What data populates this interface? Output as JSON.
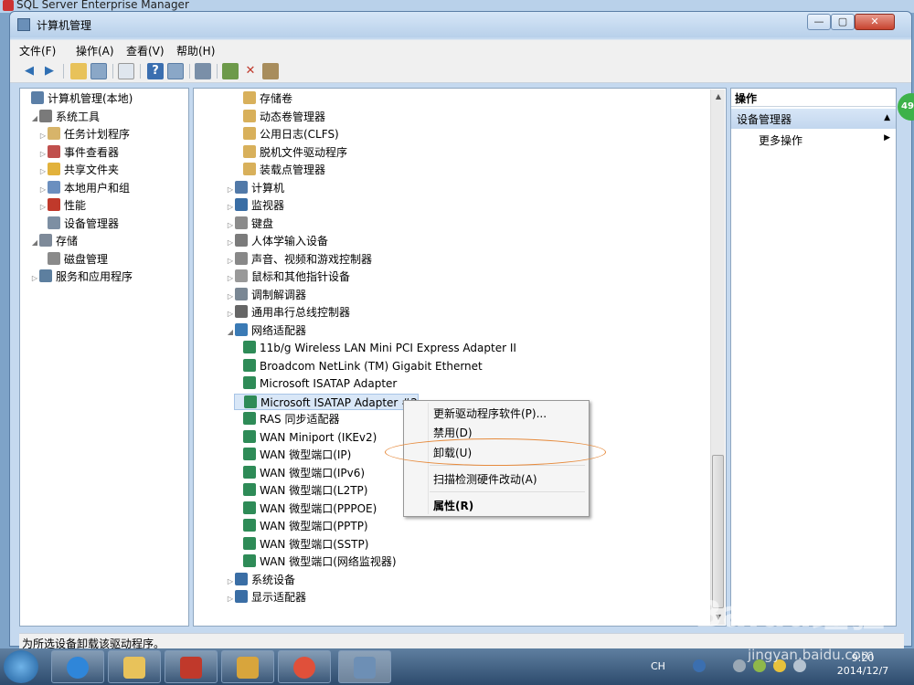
{
  "background_window_title": "SQL Server Enterprise Manager",
  "window": {
    "title": "计算机管理",
    "min": "—",
    "max": "▢",
    "close": "✕"
  },
  "menu": [
    "文件(F)",
    "操作(A)",
    "查看(V)",
    "帮助(H)"
  ],
  "left_tree": [
    {
      "label": "计算机管理(本地)",
      "level": 0,
      "arrow": "",
      "icon": "computer-mgmt-icon",
      "color": "#5b7fa7"
    },
    {
      "label": "系统工具",
      "level": 1,
      "arrow": "◢",
      "icon": "tools-icon",
      "color": "#7a7a7a"
    },
    {
      "label": "任务计划程序",
      "level": 2,
      "arrow": "▷",
      "icon": "clock-icon",
      "color": "#d7b46a"
    },
    {
      "label": "事件查看器",
      "level": 2,
      "arrow": "▷",
      "icon": "event-viewer-icon",
      "color": "#c0504d"
    },
    {
      "label": "共享文件夹",
      "level": 2,
      "arrow": "▷",
      "icon": "shared-folder-icon",
      "color": "#e2b23c"
    },
    {
      "label": "本地用户和组",
      "level": 2,
      "arrow": "▷",
      "icon": "users-icon",
      "color": "#6b8fbf"
    },
    {
      "label": "性能",
      "level": 2,
      "arrow": "▷",
      "icon": "performance-icon",
      "color": "#c0392b"
    },
    {
      "label": "设备管理器",
      "level": 2,
      "arrow": "",
      "icon": "device-manager-icon",
      "color": "#7d8fa3"
    },
    {
      "label": "存储",
      "level": 1,
      "arrow": "◢",
      "icon": "storage-icon",
      "color": "#7e8a99"
    },
    {
      "label": "磁盘管理",
      "level": 2,
      "arrow": "",
      "icon": "disk-icon",
      "color": "#8a8a8a"
    },
    {
      "label": "服务和应用程序",
      "level": 1,
      "arrow": "▷",
      "icon": "services-icon",
      "color": "#5d7f9f"
    }
  ],
  "device_tree": [
    {
      "label": "存储卷",
      "level": 2,
      "arrow": "",
      "icon": "volume-icon",
      "color": "#d8b05b"
    },
    {
      "label": "动态卷管理器",
      "level": 2,
      "arrow": "",
      "icon": "volume-icon",
      "color": "#d8b05b"
    },
    {
      "label": "公用日志(CLFS)",
      "level": 2,
      "arrow": "",
      "icon": "volume-icon",
      "color": "#d8b05b"
    },
    {
      "label": "脱机文件驱动程序",
      "level": 2,
      "arrow": "",
      "icon": "volume-icon",
      "color": "#d8b05b"
    },
    {
      "label": "装载点管理器",
      "level": 2,
      "arrow": "",
      "icon": "volume-icon",
      "color": "#d8b05b"
    },
    {
      "label": "计算机",
      "level": 1,
      "arrow": "▷",
      "icon": "computer-icon",
      "color": "#5179a8"
    },
    {
      "label": "监视器",
      "level": 1,
      "arrow": "▷",
      "icon": "monitor-icon",
      "color": "#3a6ea5"
    },
    {
      "label": "键盘",
      "level": 1,
      "arrow": "▷",
      "icon": "keyboard-icon",
      "color": "#8b8b8b"
    },
    {
      "label": "人体学输入设备",
      "level": 1,
      "arrow": "▷",
      "icon": "hid-icon",
      "color": "#7b7b7b"
    },
    {
      "label": "声音、视频和游戏控制器",
      "level": 1,
      "arrow": "▷",
      "icon": "speaker-icon",
      "color": "#888"
    },
    {
      "label": "鼠标和其他指针设备",
      "level": 1,
      "arrow": "▷",
      "icon": "mouse-icon",
      "color": "#999"
    },
    {
      "label": "调制解调器",
      "level": 1,
      "arrow": "▷",
      "icon": "modem-icon",
      "color": "#7a8794"
    },
    {
      "label": "通用串行总线控制器",
      "level": 1,
      "arrow": "▷",
      "icon": "usb-icon",
      "color": "#666"
    },
    {
      "label": "网络适配器",
      "level": 1,
      "arrow": "◢",
      "icon": "network-icon",
      "color": "#3a7ab5"
    },
    {
      "label": "11b/g Wireless LAN Mini PCI Express Adapter II",
      "level": 2,
      "arrow": "",
      "icon": "network-adapter-icon",
      "color": "#2e8b57"
    },
    {
      "label": "Broadcom NetLink (TM) Gigabit Ethernet",
      "level": 2,
      "arrow": "",
      "icon": "network-adapter-icon",
      "color": "#2e8b57"
    },
    {
      "label": "Microsoft ISATAP Adapter",
      "level": 2,
      "arrow": "",
      "icon": "network-adapter-icon",
      "color": "#2e8b57"
    },
    {
      "label": "Microsoft ISATAP Adapter #2",
      "level": 2,
      "arrow": "",
      "icon": "network-adapter-icon",
      "color": "#2e8b57",
      "selected": true
    },
    {
      "label": "RAS 同步适配器",
      "level": 2,
      "arrow": "",
      "icon": "network-adapter-icon",
      "color": "#2e8b57"
    },
    {
      "label": "WAN Miniport (IKEv2)",
      "level": 2,
      "arrow": "",
      "icon": "network-adapter-icon",
      "color": "#2e8b57"
    },
    {
      "label": "WAN 微型端口(IP)",
      "level": 2,
      "arrow": "",
      "icon": "network-adapter-icon",
      "color": "#2e8b57"
    },
    {
      "label": "WAN 微型端口(IPv6)",
      "level": 2,
      "arrow": "",
      "icon": "network-adapter-icon",
      "color": "#2e8b57"
    },
    {
      "label": "WAN 微型端口(L2TP)",
      "level": 2,
      "arrow": "",
      "icon": "network-adapter-icon",
      "color": "#2e8b57"
    },
    {
      "label": "WAN 微型端口(PPPOE)",
      "level": 2,
      "arrow": "",
      "icon": "network-adapter-icon",
      "color": "#2e8b57"
    },
    {
      "label": "WAN 微型端口(PPTP)",
      "level": 2,
      "arrow": "",
      "icon": "network-adapter-icon",
      "color": "#2e8b57"
    },
    {
      "label": "WAN 微型端口(SSTP)",
      "level": 2,
      "arrow": "",
      "icon": "network-adapter-icon",
      "color": "#2e8b57"
    },
    {
      "label": "WAN 微型端口(网络监视器)",
      "level": 2,
      "arrow": "",
      "icon": "network-adapter-icon",
      "color": "#2e8b57"
    },
    {
      "label": "系统设备",
      "level": 1,
      "arrow": "▷",
      "icon": "system-device-icon",
      "color": "#3a6ea5"
    },
    {
      "label": "显示适配器",
      "level": 1,
      "arrow": "▷",
      "icon": "display-adapter-icon",
      "color": "#3a6ea5"
    }
  ],
  "actions": {
    "header": "操作",
    "section": "设备管理器",
    "more": "更多操作",
    "badge": "49"
  },
  "context_menu": {
    "update_driver": "更新驱动程序软件(P)...",
    "disable": "禁用(D)",
    "uninstall": "卸载(U)",
    "scan": "扫描检测硬件改动(A)",
    "properties": "属性(R)"
  },
  "status_text": "为所选设备卸载该驱动程序。",
  "tray": {
    "lang": "CH",
    "time": "9:20",
    "date": "2014/12/7"
  },
  "watermark": {
    "logo": "Baidu经验",
    "url": "jingyan.baidu.com"
  }
}
